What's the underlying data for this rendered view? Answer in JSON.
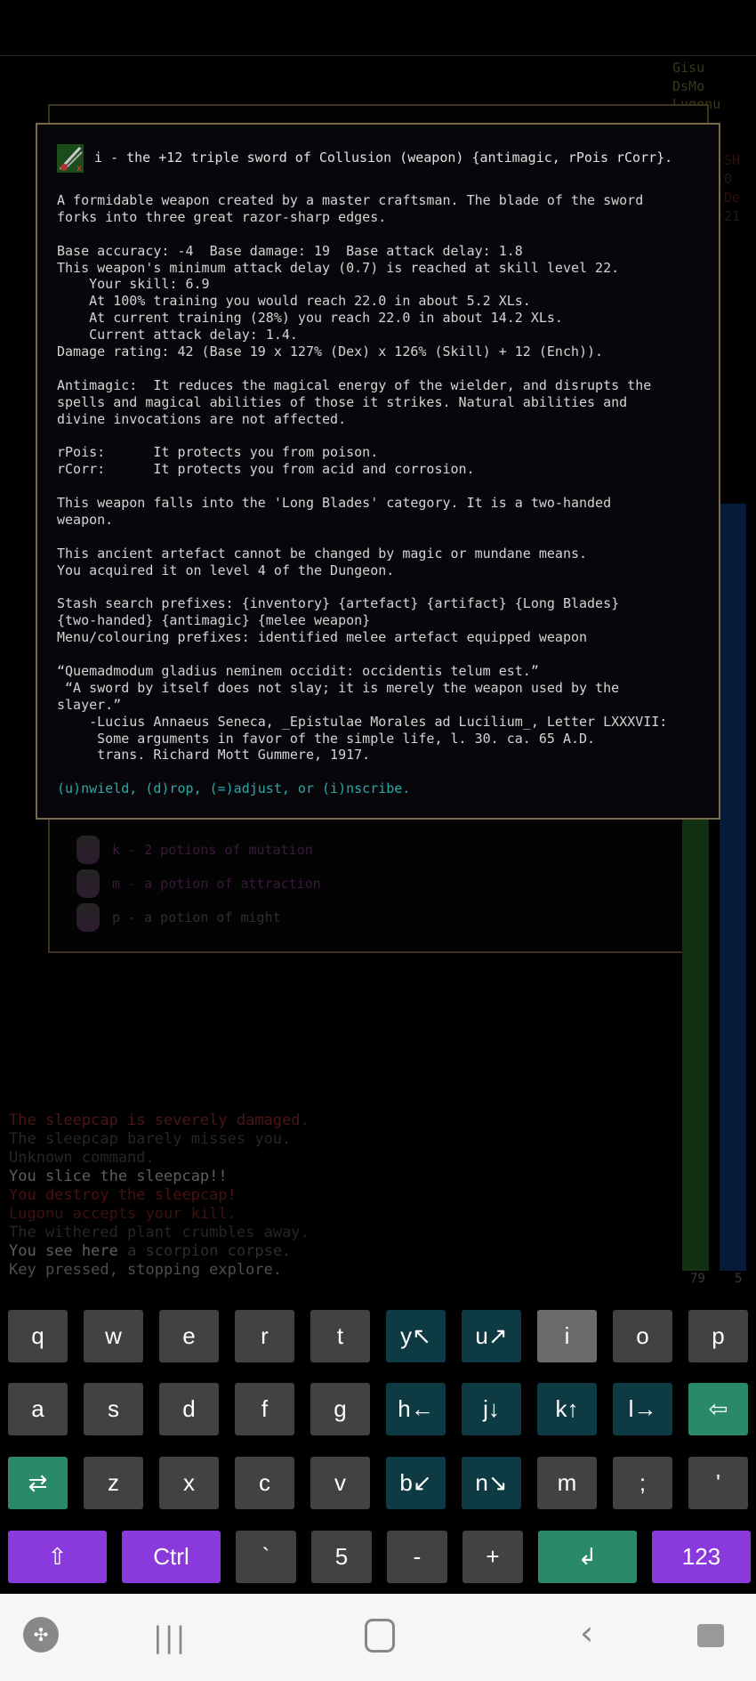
{
  "side_stats": {
    "gods": [
      "Gisu",
      "DsMo",
      "Lugonu"
    ],
    "labels": [
      "SH",
      "0",
      "De",
      "21"
    ]
  },
  "inventory_bg": {
    "items": [
      {
        "text": "k - 2 potions of mutation",
        "color": "#3a1a3a"
      },
      {
        "text": "m - a potion of attraction",
        "color": "#3a1a3a"
      },
      {
        "text": "p - a potion of might",
        "color": "#2e2e2e"
      }
    ]
  },
  "popup": {
    "title": "i - the +12 triple sword of Collusion (weapon) {antimagic, rPois rCorr}.",
    "lines": [
      "A formidable weapon created by a master craftsman. The blade of the sword",
      "forks into three great razor-sharp edges.",
      "",
      "Base accuracy: -4  Base damage: 19  Base attack delay: 1.8",
      "This weapon's minimum attack delay (0.7) is reached at skill level 22.",
      "    Your skill: 6.9",
      "    At 100% training you would reach 22.0 in about 5.2 XLs.",
      "    At current training (28%) you reach 22.0 in about 14.2 XLs.",
      "    Current attack delay: 1.4.",
      "Damage rating: 42 (Base 19 x 127% (Dex) x 126% (Skill) + 12 (Ench)).",
      "",
      "Antimagic:  It reduces the magical energy of the wielder, and disrupts the",
      "spells and magical abilities of those it strikes. Natural abilities and",
      "divine invocations are not affected.",
      "",
      "rPois:      It protects you from poison.",
      "rCorr:      It protects you from acid and corrosion.",
      "",
      "This weapon falls into the 'Long Blades' category. It is a two-handed",
      "weapon.",
      "",
      "This ancient artefact cannot be changed by magic or mundane means.",
      "You acquired it on level 4 of the Dungeon.",
      "",
      "Stash search prefixes: {inventory} {artefact} {artifact} {Long Blades}",
      "{two-handed} {antimagic} {melee weapon}",
      "Menu/colouring prefixes: identified melee artefact equipped weapon",
      "",
      "“Quemadmodum gladius neminem occidit: occidentis telum est.”",
      " “A sword by itself does not slay; it is merely the weapon used by the",
      "slayer.”",
      "    -Lucius Annaeus Seneca, _Epistulae Morales ad Lucilium_, Letter LXXXVII:",
      "     Some arguments in favor of the simple life, l. 30. ca. 65 A.D.",
      "     trans. Richard Mott Gummere, 1917.",
      ""
    ],
    "prompt": "(u)nwield, (d)rop, (=)adjust, or (i)nscribe."
  },
  "bars": {
    "green_value": "79",
    "blue_value": "5"
  },
  "message_log": [
    {
      "text": "The sleepcap is severely damaged.",
      "color": "#4a1616"
    },
    {
      "text": "The sleepcap barely misses you.",
      "color": "#262626"
    },
    {
      "text": "Unknown command.",
      "color": "#262626"
    },
    {
      "text": "You slice the sleepcap!!",
      "color": "#5e5e5e"
    },
    {
      "text": "You destroy the sleepcap!",
      "color": "#4a1010"
    },
    {
      "text": "Lugonu accepts your kill.",
      "color": "#3e1010"
    },
    {
      "text": "The withered plant crumbles away.",
      "color": "#262626"
    },
    {
      "text": "You see here ",
      "color": "#5e5e5e",
      "extra": "a scorpion corpse.",
      "extra_color": "#2e2e2e"
    },
    {
      "text": "Key pressed, stopping explore.",
      "color": "#4e4e4e"
    }
  ],
  "colors": {
    "key": "#424242",
    "key_active": "#6a6a6a",
    "key_dir": "#0e3a44",
    "key_green": "#2a8a68",
    "key_purple": "#8a3adc"
  },
  "keyboard": {
    "rows": [
      [
        {
          "l": "q"
        },
        {
          "l": "w"
        },
        {
          "l": "e"
        },
        {
          "l": "r"
        },
        {
          "l": "t"
        },
        {
          "l": "y↖",
          "t": "dir"
        },
        {
          "l": "u↗",
          "t": "dir"
        },
        {
          "l": "i",
          "t": "active"
        },
        {
          "l": "o"
        },
        {
          "l": "p"
        }
      ],
      [
        {
          "l": "a"
        },
        {
          "l": "s"
        },
        {
          "l": "d"
        },
        {
          "l": "f"
        },
        {
          "l": "g"
        },
        {
          "l": "h←",
          "t": "dir"
        },
        {
          "l": "j↓",
          "t": "dir"
        },
        {
          "l": "k↑",
          "t": "dir"
        },
        {
          "l": "l→",
          "t": "dir"
        },
        {
          "l": "⇦",
          "t": "green",
          "n": "backspace"
        }
      ],
      [
        {
          "l": "⇄",
          "t": "green",
          "n": "tab"
        },
        {
          "l": "z"
        },
        {
          "l": "x"
        },
        {
          "l": "c"
        },
        {
          "l": "v"
        },
        {
          "l": "b↙",
          "t": "dir"
        },
        {
          "l": "n↘",
          "t": "dir"
        },
        {
          "l": "m"
        },
        {
          "l": ";"
        },
        {
          "l": "'"
        }
      ]
    ],
    "bottom": [
      {
        "l": "⇧",
        "t": "purple",
        "n": "shift",
        "w": 2
      },
      {
        "l": "Ctrl",
        "t": "purple",
        "n": "ctrl",
        "w": 2
      },
      {
        "l": "`"
      },
      {
        "l": "5"
      },
      {
        "l": "-"
      },
      {
        "l": "+"
      },
      {
        "l": "↲",
        "t": "green",
        "n": "enter",
        "w": 2
      },
      {
        "l": "123",
        "t": "purple",
        "n": "numbers",
        "w": 2
      }
    ]
  },
  "navbar": {
    "icons": [
      "game-launcher-icon",
      "recent-apps-icon",
      "home-icon",
      "back-icon",
      "video-record-icon"
    ]
  }
}
